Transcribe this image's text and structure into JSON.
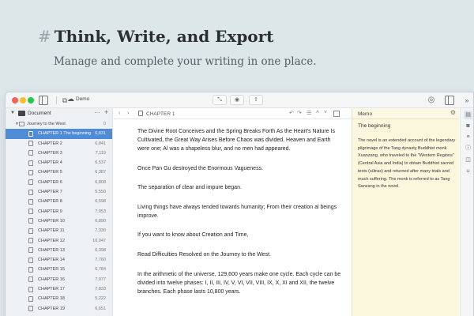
{
  "hero": {
    "title": "Think, Write, and Export",
    "subtitle": "Manage and complete your writing in one place."
  },
  "toolbar": {
    "project_name": "Demo"
  },
  "sidebar": {
    "root_label": "Document",
    "root_more": "···",
    "root_add": "+",
    "folder": {
      "label": "Journey to the West",
      "count": "0"
    },
    "chapters": [
      {
        "label": "CHAPTER 1 The beginning",
        "count": "6,831",
        "selected": true
      },
      {
        "label": "CHAPTER 2",
        "count": "6,841"
      },
      {
        "label": "CHAPTER 3",
        "count": "7,119"
      },
      {
        "label": "CHAPTER 4",
        "count": "6,537"
      },
      {
        "label": "CHAPTER 5",
        "count": "6,387"
      },
      {
        "label": "CHAPTER 6",
        "count": "6,808"
      },
      {
        "label": "CHAPTER 7",
        "count": "5,550"
      },
      {
        "label": "CHAPTER 8",
        "count": "6,598"
      },
      {
        "label": "CHAPTER 9",
        "count": "7,053"
      },
      {
        "label": "CHAPTER 10",
        "count": "6,890"
      },
      {
        "label": "CHAPTER 11",
        "count": "7,330"
      },
      {
        "label": "CHAPTER 12",
        "count": "10,047"
      },
      {
        "label": "CHAPTER 13",
        "count": "6,398"
      },
      {
        "label": "CHAPTER 14",
        "count": "7,760"
      },
      {
        "label": "CHAPTER 15",
        "count": "6,784"
      },
      {
        "label": "CHAPTER 16",
        "count": "7,077"
      },
      {
        "label": "CHAPTER 17",
        "count": "7,833"
      },
      {
        "label": "CHAPTER 18",
        "count": "5,222"
      },
      {
        "label": "CHAPTER 19",
        "count": "6,651"
      }
    ]
  },
  "editor": {
    "doc_title": "CHAPTER 1",
    "paragraphs": [
      "The Divine Root Conceives and the Spring Breaks Forth As the Heart's Nature Is Cultivated, the Great Way Arises Before Chaos was divided, Heaven and Earth were one; Al was a shapeless blur, and no men had appeared.",
      "Once Pan Gu destroyed the Enormous Vagueness.",
      "The separation of clear and impure began.",
      "Living things have always tended towards humanity; From their creation al beings improve.",
      "If you want to know about Creation and Time,",
      "Read Difficulties Resolved on the Journey to the West.",
      "In the arithmetic of the universe, 129,600 years make one cycle. Each cycle can be divided into twelve phases: I, II, III, IV, V, VI, VII, VIII, IX, X, XI and XII, the twelve branches. Each phase lasts 10,800 years."
    ]
  },
  "memo": {
    "label": "Memo",
    "heading": "The beginning",
    "text": "The novel is an extended account of the legendary pilgrimage of the Tang dynasty Buddhist monk Xuanzang, who traveled to the \"Western Regions\" (Central Asia and India) to obtain Buddhist sacred texts (sūtras) and returned after many trials and much suffering. The monk is referred to as Tang Sanzang in the novel."
  }
}
